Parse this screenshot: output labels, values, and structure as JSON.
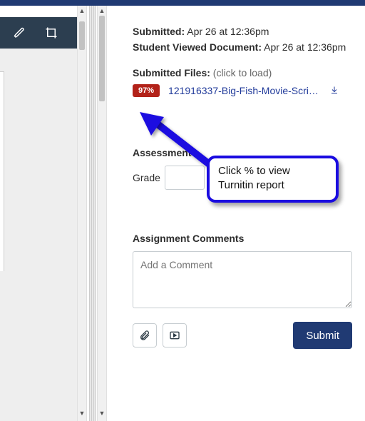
{
  "meta": {
    "submitted_label": "Submitted:",
    "submitted_value": "Apr 26 at 12:36pm",
    "viewed_label": "Student Viewed Document:",
    "viewed_value": "Apr 26 at 12:36pm",
    "files_label": "Submitted Files:",
    "files_hint": "(click to load)"
  },
  "file": {
    "tii_percent": "97%",
    "filename": "121916337-Big-Fish-Movie-Script.…"
  },
  "assessment": {
    "heading": "Assessment",
    "grade_label": "Grade"
  },
  "comments": {
    "heading": "Assignment Comments",
    "placeholder": "Add a Comment"
  },
  "buttons": {
    "submit": "Submit"
  },
  "callout": {
    "line1": "Click % to view",
    "line2": "Turnitin report"
  }
}
